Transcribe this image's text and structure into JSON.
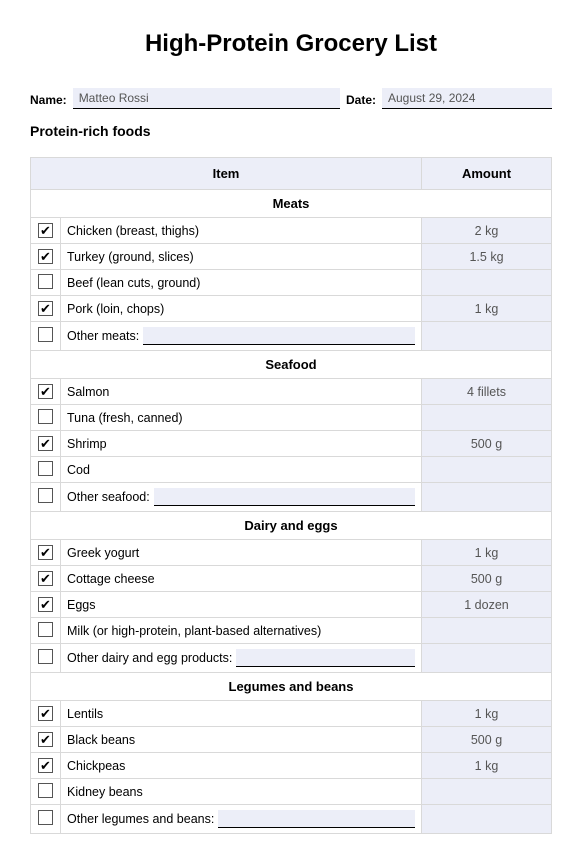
{
  "title": "High-Protein Grocery List",
  "nameLabel": "Name:",
  "nameValue": "Matteo Rossi",
  "dateLabel": "Date:",
  "dateValue": "August 29, 2024",
  "sectionTitle": "Protein-rich foods",
  "headers": {
    "item": "Item",
    "amount": "Amount"
  },
  "categories": [
    {
      "name": "Meats",
      "rows": [
        {
          "checked": true,
          "item": "Chicken (breast, thighs)",
          "amount": "2 kg"
        },
        {
          "checked": true,
          "item": "Turkey (ground, slices)",
          "amount": "1.5 kg"
        },
        {
          "checked": false,
          "item": "Beef (lean cuts, ground)",
          "amount": ""
        },
        {
          "checked": true,
          "item": "Pork (loin, chops)",
          "amount": "1 kg"
        },
        {
          "checked": false,
          "item": "Other meats:",
          "amount": "",
          "other": true
        }
      ]
    },
    {
      "name": "Seafood",
      "rows": [
        {
          "checked": true,
          "item": "Salmon",
          "amount": "4 fillets"
        },
        {
          "checked": false,
          "item": "Tuna (fresh, canned)",
          "amount": ""
        },
        {
          "checked": true,
          "item": "Shrimp",
          "amount": "500 g"
        },
        {
          "checked": false,
          "item": "Cod",
          "amount": ""
        },
        {
          "checked": false,
          "item": "Other seafood:",
          "amount": "",
          "other": true
        }
      ]
    },
    {
      "name": "Dairy and eggs",
      "rows": [
        {
          "checked": true,
          "item": "Greek yogurt",
          "amount": "1 kg"
        },
        {
          "checked": true,
          "item": "Cottage cheese",
          "amount": "500 g"
        },
        {
          "checked": true,
          "item": "Eggs",
          "amount": "1 dozen"
        },
        {
          "checked": false,
          "item": "Milk (or high-protein, plant-based alternatives)",
          "amount": ""
        },
        {
          "checked": false,
          "item": "Other dairy and egg products:",
          "amount": "",
          "other": true
        }
      ]
    },
    {
      "name": "Legumes and beans",
      "rows": [
        {
          "checked": true,
          "item": "Lentils",
          "amount": "1 kg"
        },
        {
          "checked": true,
          "item": "Black beans",
          "amount": "500 g"
        },
        {
          "checked": true,
          "item": "Chickpeas",
          "amount": "1 kg"
        },
        {
          "checked": false,
          "item": "Kidney beans",
          "amount": ""
        },
        {
          "checked": false,
          "item": "Other legumes and beans:",
          "amount": "",
          "other": true
        }
      ]
    }
  ]
}
